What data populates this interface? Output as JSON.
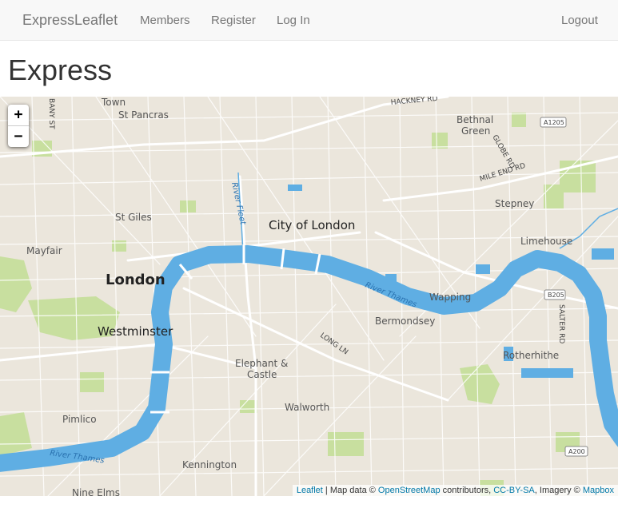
{
  "navbar": {
    "brand": "ExpressLeaflet",
    "links": [
      "Members",
      "Register",
      "Log In"
    ],
    "logout": "Logout"
  },
  "page": {
    "title": "Express"
  },
  "map": {
    "zoom": {
      "in_label": "+",
      "out_label": "−"
    },
    "colors": {
      "water": "#5faee3",
      "park": "#c8df9f",
      "land": "#ebe6dc",
      "road": "#ffffff"
    },
    "places": {
      "london": "London",
      "city_of_london": "City of London",
      "westminster": "Westminster",
      "town": "Town",
      "st_pancras": "St Pancras",
      "st_giles": "St Giles",
      "mayfair": "Mayfair",
      "bethnal_green_1": "Bethnal",
      "bethnal_green_2": "Green",
      "stepney": "Stepney",
      "limehouse": "Limehouse",
      "wapping": "Wapping",
      "bermondsey": "Bermondsey",
      "rotherhithe": "Rotherhithe",
      "elephant_1": "Elephant &",
      "elephant_2": "Castle",
      "walworth": "Walworth",
      "pimlico": "Pimlico",
      "kennington": "Kennington",
      "nine_elms": "Nine Elms"
    },
    "roads": {
      "hackney": "HACKNEY RD",
      "globe": "GLOBE RD",
      "mile_end": "MILE END RD",
      "long_ln": "LONG LN",
      "salter": "SALTER RD",
      "bany": "BANY ST"
    },
    "shields": {
      "a1205": "A1205",
      "b205": "B205",
      "a200": "A200"
    },
    "rivers": {
      "fleet": "River Fleet",
      "thames_east": "River Thames",
      "thames_west": "River Thames"
    },
    "attribution": {
      "leaflet": "Leaflet",
      "sep1": " | Map data © ",
      "osm": "OpenStreetMap",
      "sep2": " contributors, ",
      "license": "CC-BY-SA",
      "sep3": ", Imagery © ",
      "mapbox": "Mapbox"
    }
  }
}
